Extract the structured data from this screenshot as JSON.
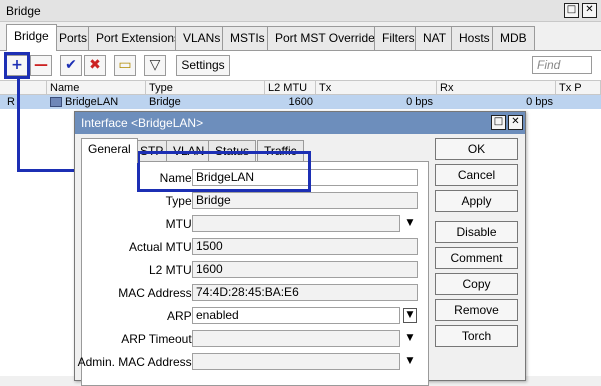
{
  "window": {
    "title": "Bridge",
    "controls": [
      "restore-icon",
      "close-icon"
    ]
  },
  "tabs": [
    "Bridge",
    "Ports",
    "Port Extensions",
    "VLANs",
    "MSTIs",
    "Port MST Overrides",
    "Filters",
    "NAT",
    "Hosts",
    "MDB"
  ],
  "toolbar": {
    "settings_label": "Settings",
    "find_placeholder": "Find",
    "icons": [
      "add-icon",
      "remove-icon",
      "enable-icon",
      "disable-icon",
      "comment-icon",
      "filter-icon"
    ]
  },
  "table": {
    "columns": [
      "Name",
      "Type",
      "L2 MTU",
      "Tx",
      "Rx",
      "Tx P"
    ],
    "rows": [
      {
        "flag": "R",
        "name": "BridgeLAN",
        "type": "Bridge",
        "l2mtu": "1600",
        "tx": "0 bps",
        "rx": "0 bps"
      }
    ]
  },
  "dialog": {
    "title": "Interface <BridgeLAN>",
    "tabs": [
      "General",
      "STP",
      "VLAN",
      "Status",
      "Traffic"
    ],
    "fields": {
      "name": {
        "label": "Name:",
        "value": "BridgeLAN"
      },
      "type": {
        "label": "Type:",
        "value": "Bridge"
      },
      "mtu": {
        "label": "MTU:",
        "value": ""
      },
      "actual_mtu": {
        "label": "Actual MTU:",
        "value": "1500"
      },
      "l2_mtu": {
        "label": "L2 MTU:",
        "value": "1600"
      },
      "mac_address": {
        "label": "MAC Address:",
        "value": "74:4D:28:45:BA:E6"
      },
      "arp": {
        "label": "ARP:",
        "value": "enabled"
      },
      "arp_timeout": {
        "label": "ARP Timeout:",
        "value": ""
      },
      "admin_mac": {
        "label": "Admin. MAC Address:",
        "value": ""
      }
    },
    "buttons": {
      "ok": "OK",
      "cancel": "Cancel",
      "apply": "Apply",
      "disable": "Disable",
      "comment": "Comment",
      "copy": "Copy",
      "remove": "Remove",
      "torch": "Torch"
    }
  },
  "colors": {
    "highlight": "#1c2fb4",
    "dialog_title": "#6d8ebc",
    "selected_row": "#bcd3ef"
  }
}
